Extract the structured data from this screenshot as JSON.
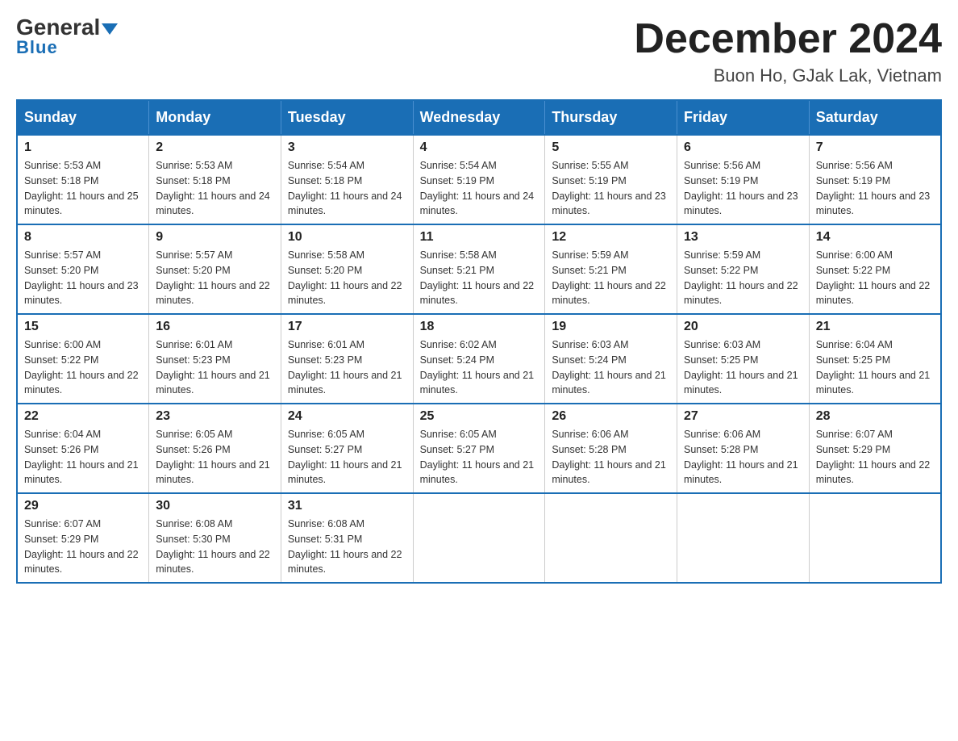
{
  "logo": {
    "general": "General",
    "blue": "Blue"
  },
  "header": {
    "month": "December 2024",
    "location": "Buon Ho, GJak Lak, Vietnam"
  },
  "weekdays": [
    "Sunday",
    "Monday",
    "Tuesday",
    "Wednesday",
    "Thursday",
    "Friday",
    "Saturday"
  ],
  "weeks": [
    [
      {
        "day": "1",
        "sunrise": "Sunrise: 5:53 AM",
        "sunset": "Sunset: 5:18 PM",
        "daylight": "Daylight: 11 hours and 25 minutes."
      },
      {
        "day": "2",
        "sunrise": "Sunrise: 5:53 AM",
        "sunset": "Sunset: 5:18 PM",
        "daylight": "Daylight: 11 hours and 24 minutes."
      },
      {
        "day": "3",
        "sunrise": "Sunrise: 5:54 AM",
        "sunset": "Sunset: 5:18 PM",
        "daylight": "Daylight: 11 hours and 24 minutes."
      },
      {
        "day": "4",
        "sunrise": "Sunrise: 5:54 AM",
        "sunset": "Sunset: 5:19 PM",
        "daylight": "Daylight: 11 hours and 24 minutes."
      },
      {
        "day": "5",
        "sunrise": "Sunrise: 5:55 AM",
        "sunset": "Sunset: 5:19 PM",
        "daylight": "Daylight: 11 hours and 23 minutes."
      },
      {
        "day": "6",
        "sunrise": "Sunrise: 5:56 AM",
        "sunset": "Sunset: 5:19 PM",
        "daylight": "Daylight: 11 hours and 23 minutes."
      },
      {
        "day": "7",
        "sunrise": "Sunrise: 5:56 AM",
        "sunset": "Sunset: 5:19 PM",
        "daylight": "Daylight: 11 hours and 23 minutes."
      }
    ],
    [
      {
        "day": "8",
        "sunrise": "Sunrise: 5:57 AM",
        "sunset": "Sunset: 5:20 PM",
        "daylight": "Daylight: 11 hours and 23 minutes."
      },
      {
        "day": "9",
        "sunrise": "Sunrise: 5:57 AM",
        "sunset": "Sunset: 5:20 PM",
        "daylight": "Daylight: 11 hours and 22 minutes."
      },
      {
        "day": "10",
        "sunrise": "Sunrise: 5:58 AM",
        "sunset": "Sunset: 5:20 PM",
        "daylight": "Daylight: 11 hours and 22 minutes."
      },
      {
        "day": "11",
        "sunrise": "Sunrise: 5:58 AM",
        "sunset": "Sunset: 5:21 PM",
        "daylight": "Daylight: 11 hours and 22 minutes."
      },
      {
        "day": "12",
        "sunrise": "Sunrise: 5:59 AM",
        "sunset": "Sunset: 5:21 PM",
        "daylight": "Daylight: 11 hours and 22 minutes."
      },
      {
        "day": "13",
        "sunrise": "Sunrise: 5:59 AM",
        "sunset": "Sunset: 5:22 PM",
        "daylight": "Daylight: 11 hours and 22 minutes."
      },
      {
        "day": "14",
        "sunrise": "Sunrise: 6:00 AM",
        "sunset": "Sunset: 5:22 PM",
        "daylight": "Daylight: 11 hours and 22 minutes."
      }
    ],
    [
      {
        "day": "15",
        "sunrise": "Sunrise: 6:00 AM",
        "sunset": "Sunset: 5:22 PM",
        "daylight": "Daylight: 11 hours and 22 minutes."
      },
      {
        "day": "16",
        "sunrise": "Sunrise: 6:01 AM",
        "sunset": "Sunset: 5:23 PM",
        "daylight": "Daylight: 11 hours and 21 minutes."
      },
      {
        "day": "17",
        "sunrise": "Sunrise: 6:01 AM",
        "sunset": "Sunset: 5:23 PM",
        "daylight": "Daylight: 11 hours and 21 minutes."
      },
      {
        "day": "18",
        "sunrise": "Sunrise: 6:02 AM",
        "sunset": "Sunset: 5:24 PM",
        "daylight": "Daylight: 11 hours and 21 minutes."
      },
      {
        "day": "19",
        "sunrise": "Sunrise: 6:03 AM",
        "sunset": "Sunset: 5:24 PM",
        "daylight": "Daylight: 11 hours and 21 minutes."
      },
      {
        "day": "20",
        "sunrise": "Sunrise: 6:03 AM",
        "sunset": "Sunset: 5:25 PM",
        "daylight": "Daylight: 11 hours and 21 minutes."
      },
      {
        "day": "21",
        "sunrise": "Sunrise: 6:04 AM",
        "sunset": "Sunset: 5:25 PM",
        "daylight": "Daylight: 11 hours and 21 minutes."
      }
    ],
    [
      {
        "day": "22",
        "sunrise": "Sunrise: 6:04 AM",
        "sunset": "Sunset: 5:26 PM",
        "daylight": "Daylight: 11 hours and 21 minutes."
      },
      {
        "day": "23",
        "sunrise": "Sunrise: 6:05 AM",
        "sunset": "Sunset: 5:26 PM",
        "daylight": "Daylight: 11 hours and 21 minutes."
      },
      {
        "day": "24",
        "sunrise": "Sunrise: 6:05 AM",
        "sunset": "Sunset: 5:27 PM",
        "daylight": "Daylight: 11 hours and 21 minutes."
      },
      {
        "day": "25",
        "sunrise": "Sunrise: 6:05 AM",
        "sunset": "Sunset: 5:27 PM",
        "daylight": "Daylight: 11 hours and 21 minutes."
      },
      {
        "day": "26",
        "sunrise": "Sunrise: 6:06 AM",
        "sunset": "Sunset: 5:28 PM",
        "daylight": "Daylight: 11 hours and 21 minutes."
      },
      {
        "day": "27",
        "sunrise": "Sunrise: 6:06 AM",
        "sunset": "Sunset: 5:28 PM",
        "daylight": "Daylight: 11 hours and 21 minutes."
      },
      {
        "day": "28",
        "sunrise": "Sunrise: 6:07 AM",
        "sunset": "Sunset: 5:29 PM",
        "daylight": "Daylight: 11 hours and 22 minutes."
      }
    ],
    [
      {
        "day": "29",
        "sunrise": "Sunrise: 6:07 AM",
        "sunset": "Sunset: 5:29 PM",
        "daylight": "Daylight: 11 hours and 22 minutes."
      },
      {
        "day": "30",
        "sunrise": "Sunrise: 6:08 AM",
        "sunset": "Sunset: 5:30 PM",
        "daylight": "Daylight: 11 hours and 22 minutes."
      },
      {
        "day": "31",
        "sunrise": "Sunrise: 6:08 AM",
        "sunset": "Sunset: 5:31 PM",
        "daylight": "Daylight: 11 hours and 22 minutes."
      },
      null,
      null,
      null,
      null
    ]
  ]
}
